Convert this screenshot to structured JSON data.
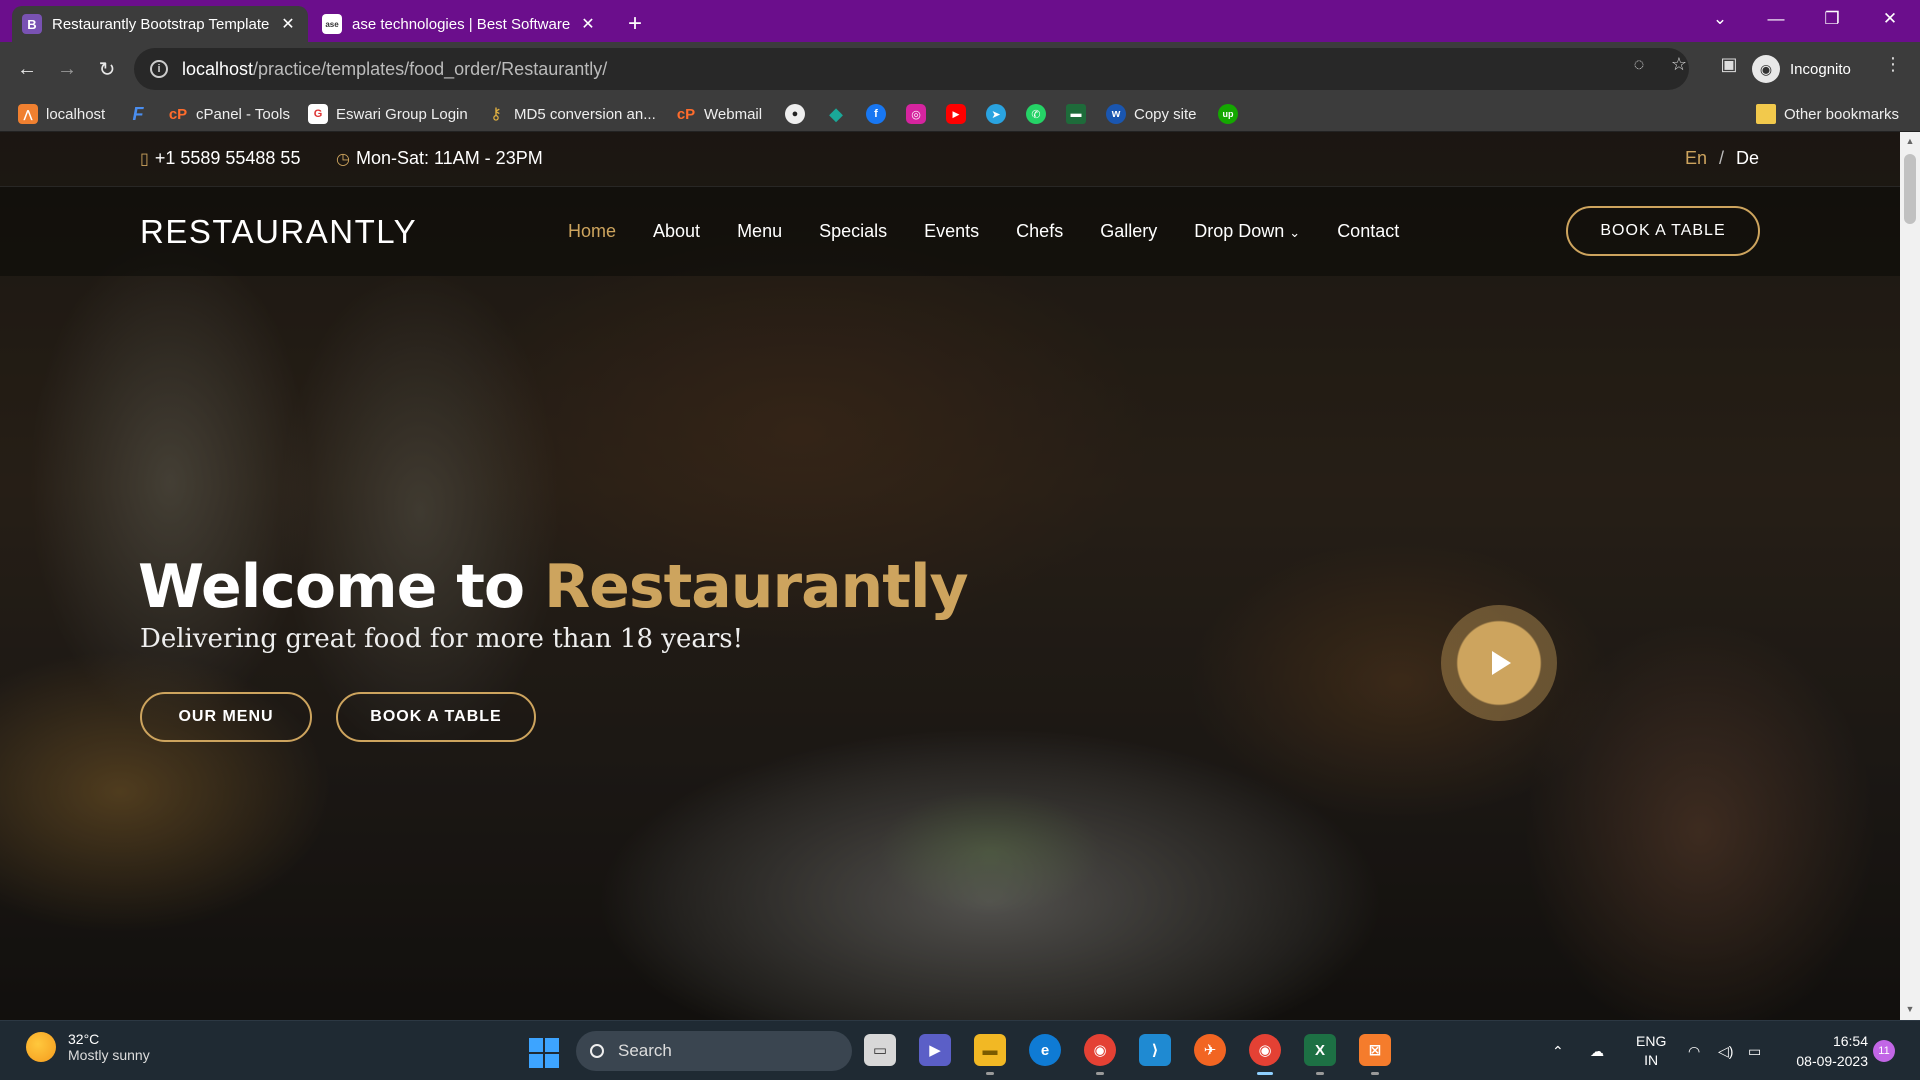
{
  "browser": {
    "tabs": [
      {
        "title": "Restaurantly Bootstrap Template",
        "favicon": "B",
        "active": true
      },
      {
        "title": "ase technologies | Best Software",
        "favicon": "ase",
        "active": false
      }
    ],
    "new_tab_label": "+",
    "window_controls": {
      "tab_search": "⌄",
      "minimize": "—",
      "restore": "❐",
      "close": "✕"
    },
    "url": {
      "host": "localhost",
      "path": "/practice/templates/food_order/Restaurantly/"
    },
    "profile_label": "Incognito",
    "bookmarks": [
      {
        "label": "localhost",
        "icon": "xampp-icon",
        "color": "#f08030"
      },
      {
        "label": "",
        "icon": "f-icon",
        "color": "#2a6bd6"
      },
      {
        "label": "cPanel - Tools",
        "icon": "cpanel-icon",
        "color": "#ff6c2c"
      },
      {
        "label": "Eswari Group Login",
        "icon": "eswari-icon",
        "color": "#d33"
      },
      {
        "label": "MD5 conversion an...",
        "icon": "key-icon",
        "color": "#e0b040"
      },
      {
        "label": "Webmail",
        "icon": "cpanel-icon",
        "color": "#ff6c2c"
      },
      {
        "label": "",
        "icon": "github-icon",
        "color": "#333"
      },
      {
        "label": "",
        "icon": "diamond-icon",
        "color": "#1aa898"
      },
      {
        "label": "",
        "icon": "facebook-icon",
        "color": "#1877f2"
      },
      {
        "label": "",
        "icon": "instagram-icon",
        "color": "#d6249f"
      },
      {
        "label": "",
        "icon": "youtube-icon",
        "color": "#ff0000"
      },
      {
        "label": "",
        "icon": "telegram-icon",
        "color": "#2aa3e0"
      },
      {
        "label": "",
        "icon": "whatsapp-icon",
        "color": "#25d366"
      },
      {
        "label": "",
        "icon": "folder-icon",
        "color": "#1e6b3a"
      },
      {
        "label": "Copy site",
        "icon": "w-icon",
        "color": "#1a56b0"
      },
      {
        "label": "",
        "icon": "upwork-icon",
        "color": "#14a800"
      }
    ],
    "other_bookmarks": "Other bookmarks"
  },
  "site": {
    "phone": "+1 5589 55488 55",
    "hours": "Mon-Sat: 11AM - 23PM",
    "languages": {
      "en": "En",
      "sep": "/",
      "de": "De"
    },
    "logo": "RESTAURANTLY",
    "nav": [
      "Home",
      "About",
      "Menu",
      "Specials",
      "Events",
      "Chefs",
      "Gallery",
      "Drop Down",
      "Contact"
    ],
    "book_table": "BOOK A TABLE",
    "hero": {
      "title_prefix": "Welcome to ",
      "title_accent": "Restaurantly",
      "subtitle": "Delivering great food for more than 18 years!",
      "btn_menu": "OUR MENU",
      "btn_book": "BOOK A TABLE"
    },
    "accent_color": "#cda45e"
  },
  "taskbar": {
    "weather_temp": "32°C",
    "weather_desc": "Mostly sunny",
    "search_label": "Search",
    "lang_line1": "ENG",
    "lang_line2": "IN",
    "time": "16:54",
    "date": "08-09-2023",
    "notifications": "11"
  }
}
